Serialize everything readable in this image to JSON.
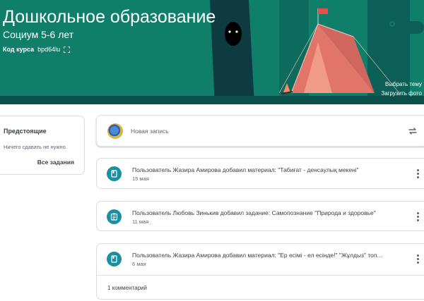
{
  "banner": {
    "title": "Дошкольное образование",
    "subtitle": "Социум 5-6 лет",
    "code_label": "Код курса",
    "code_value": "bpd64lu",
    "select_theme": "Выбрать тему",
    "upload_photo": "Загрузить фото",
    "colors": {
      "background": "#0f7f6a",
      "tree": "#0d3b3f",
      "tent": "#e2756a"
    }
  },
  "upcoming": {
    "title": "Предстоящие",
    "empty": "Ничего сдавать не нужно.",
    "all_link": "Все задания"
  },
  "composer": {
    "placeholder": "Новая запись"
  },
  "posts": [
    {
      "icon": "material-icon",
      "text": "Пользователь Жазира Амирова добавил материал: \"Табиғат - денсаулық мекені\"",
      "date": "15 мая"
    },
    {
      "icon": "assignment-icon",
      "text": "Пользователь Любовь Зинькив добавил задание: Самопознание \"Природа и здоровье\"",
      "date": "11 мая"
    },
    {
      "icon": "material-icon",
      "text": "Пользователь Жазира Амирова добавил материал: \"Ер есімі - ел есінде!\" \"Жұлдыз\" топ...",
      "date": "6 мая",
      "comments": "1 комментарий"
    }
  ]
}
